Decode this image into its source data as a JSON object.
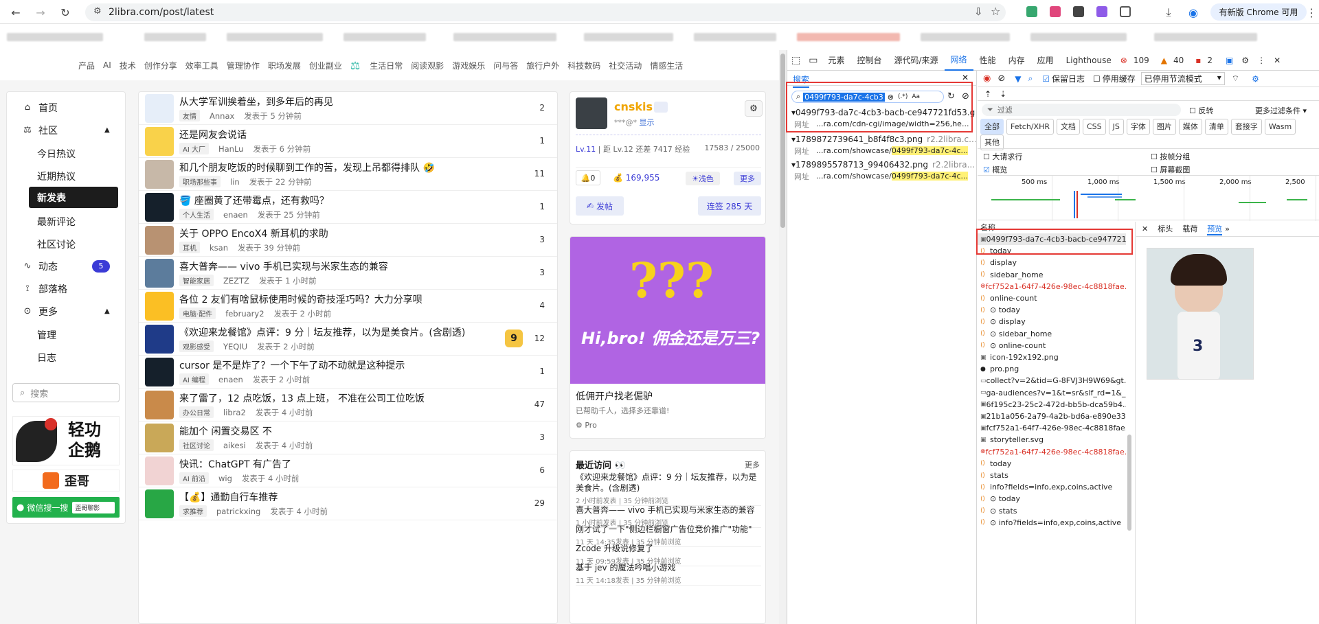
{
  "browser": {
    "url": "2libra.com/post/latest",
    "update_label": "有新版 Chrome 可用"
  },
  "topnav": [
    "产品",
    "AI",
    "技术",
    "创作分享",
    "效率工具",
    "管理协作",
    "职场发展",
    "创业副业",
    "生活日常",
    "阅读观影",
    "游戏娱乐",
    "问与答",
    "旅行户外",
    "科技数码",
    "社交活动",
    "情感生活"
  ],
  "sidebar": {
    "home": "首页",
    "community": "社区",
    "sub1": [
      "今日热议",
      "近期热议"
    ],
    "new_posts": "新发表",
    "sub2": [
      "最新评论",
      "社区讨论"
    ],
    "activity": "动态",
    "activity_count": "5",
    "tribe": "部落格",
    "more": "更多",
    "sub3": [
      "管理",
      "日志"
    ],
    "search_placeholder": "搜索",
    "promo1_text": "轻功\n企鹅",
    "promo2_text": "歪哥",
    "promo3_text": "微信搜一搜",
    "promo3_box": "歪哥聊影"
  },
  "posts": [
    {
      "title": "从大学军训挨着坐，到多年后的再见",
      "tag": "友情",
      "author": "Annax",
      "time": "发表于 5 分钟前",
      "count": "2"
    },
    {
      "title": "还是网友会说话",
      "tag": "AI 大厂",
      "author": "HanLu",
      "time": "发表于 6 分钟前",
      "count": "1"
    },
    {
      "title": "和几个朋友吃饭的时候聊到工作的苦，发现上吊都得排队 🤣",
      "tag": "职场那些事",
      "author": "lin",
      "time": "发表于 22 分钟前",
      "count": "11"
    },
    {
      "title": "🪣 座圈黄了还带霉点，还有救吗？",
      "tag": "个人生活",
      "author": "enaen",
      "time": "发表于 25 分钟前",
      "count": "1"
    },
    {
      "title": "关于 OPPO EncoX4 新耳机的求助",
      "tag": "耳机",
      "author": "ksan",
      "time": "发表于 39 分钟前",
      "count": "3"
    },
    {
      "title": "喜大普奔—— vivo 手机已实现与米家生态的兼容",
      "tag": "智能家居",
      "author": "ZEZTZ",
      "time": "发表于 1 小时前",
      "count": "3"
    },
    {
      "title": "各位 2 友们有啥鼠标使用时候的奇技淫巧吗？大力分享呗",
      "tag": "电脑·配件",
      "author": "february2",
      "time": "发表于 2 小时前",
      "count": "4"
    },
    {
      "title": "《欢迎来龙餐馆》点评：9 分｜坛友推荐，以为是美食片。(含剧透)",
      "tag": "观影感受",
      "author": "YEQIU",
      "time": "发表于 2 小时前",
      "count": "12",
      "badge": "9"
    },
    {
      "title": "cursor 是不是炸了？一个下午了动不动就是这种提示",
      "tag": "AI 编程",
      "author": "enaen",
      "time": "发表于 2 小时前",
      "count": "1"
    },
    {
      "title": "来了雷了，12 点吃饭，13 点上班， 不准在公司工位吃饭",
      "tag": "办公日常",
      "author": "libra2",
      "time": "发表于 4 小时前",
      "count": "47"
    },
    {
      "title": "能加个 闲置交易区 不",
      "tag": "社区讨论",
      "author": "aikesi",
      "time": "发表于 4 小时前",
      "count": "3"
    },
    {
      "title": "快讯：ChatGPT 有广告了",
      "tag": "AI 前沿",
      "author": "wig",
      "time": "发表于 4 小时前",
      "count": "6"
    },
    {
      "title": "【💰】通勤自行车推荐",
      "tag": "求推荐",
      "author": "patrickxing",
      "time": "发表于 4 小时前",
      "count": "29"
    }
  ],
  "profile": {
    "name": "cnskis",
    "sub": "***@*",
    "show": "显示",
    "level": "Lv.11",
    "next": "距 Lv.12 还差 7417 经验",
    "exp": "17583 / 25000",
    "bell": "0",
    "coins": "169,955",
    "color_label": "浅色",
    "more": "更多",
    "post_btn": "发帖",
    "streak": "连签 285 天"
  },
  "ad": {
    "headline": "Hi,bro! 佣金还是万三?",
    "title": "低佣开户找老倔驴",
    "desc": "已帮助千人，选择多还靠谱!",
    "pro": "Pro"
  },
  "recent": {
    "title": "最近访问 👀",
    "more": "更多",
    "items": [
      {
        "t": "《欢迎来龙餐馆》点评：9 分｜坛友推荐，以为是美食片。(含剧透)",
        "m": "2 小时前发表  |  35 分钟前浏览"
      },
      {
        "t": "喜大普奔—— vivo 手机已实现与米家生态的兼容",
        "m": "1 小时前发表  |  35 分钟前浏览"
      },
      {
        "t": "刚才试了一下\"侧边栏橱窗广告位竞价推广\"功能\"",
        "m": "11 天 14:35发表  |  35 分钟前浏览"
      },
      {
        "t": "Zcode 升级说修复了",
        "m": "11 天 09:59发表  |  35 分钟前浏览"
      },
      {
        "t": "基于 jev 的魔法吟唱小游戏",
        "m": "11 天 14:18发表  |  35 分钟前浏览"
      }
    ]
  },
  "devtools": {
    "tabs": [
      "元素",
      "控制台",
      "源代码/来源",
      "网络",
      "性能",
      "内存",
      "应用",
      "Lighthouse"
    ],
    "errors": "109",
    "warnings": "40",
    "issues": "2",
    "search_tab": "搜索",
    "search_value": "0499f793-da7c-4cb3",
    "regex": "(.*)",
    "case": "Aa",
    "results": [
      {
        "file": "0499f793-da7c-4cb3-bacb-ce947721fd53.gi...",
        "line_label": "网址",
        "line": "...ra.com/cdn-cgi/image/width=256,he..."
      },
      {
        "file": "1789872739641_b8f4f8c3.png",
        "host": "r2.2libra.c...",
        "line_label": "网址",
        "line_pre": "...ra.com/showcase/",
        "line_hl": "0499f793-da7c-4c..."
      },
      {
        "file": "1789895578713_99406432.png",
        "host": "r2.2libra...",
        "line_label": "网址",
        "line_pre": "...ra.com/showcase/",
        "line_hl": "0499f793-da7c-4c..."
      }
    ],
    "preserve_log": "保留日志",
    "disable_cache": "停用缓存",
    "throttle": "已停用节流模式",
    "filter_placeholder": "过滤",
    "invert": "反转",
    "more_filters": "更多过滤条件",
    "types": [
      "全部",
      "Fetch/XHR",
      "文档",
      "CSS",
      "JS",
      "字体",
      "图片",
      "媒体",
      "清单",
      "套接字",
      "Wasm",
      "其他"
    ],
    "big_rows": "大请求行",
    "group_frame": "按帧分组",
    "overview": "概览",
    "screenshots": "屏幕截图",
    "timeline": [
      "500 ms",
      "1,000 ms",
      "1,500 ms",
      "2,000 ms",
      "2,500"
    ],
    "col_name": "名称",
    "detail_tabs": [
      "标头",
      "载荷",
      "预览"
    ],
    "requests": [
      {
        "n": "0499f793-da7c-4cb3-bacb-ce947721...",
        "t": "img",
        "sel": true
      },
      {
        "n": "today",
        "t": "xhr"
      },
      {
        "n": "display",
        "t": "xhr"
      },
      {
        "n": "sidebar_home",
        "t": "xhr"
      },
      {
        "n": "fcf752a1-64f7-426e-98ec-4c8818fae...",
        "t": "err"
      },
      {
        "n": "online-count",
        "t": "xhr"
      },
      {
        "n": "⊙ today",
        "t": "xhr"
      },
      {
        "n": "⊙ display",
        "t": "xhr"
      },
      {
        "n": "⊙ sidebar_home",
        "t": "xhr"
      },
      {
        "n": "⊙ online-count",
        "t": "xhr"
      },
      {
        "n": "icon-192x192.png",
        "t": "img"
      },
      {
        "n": "pro.png",
        "t": "pro"
      },
      {
        "n": "collect?v=2&tid=G-8FVJ3H9W69&gt...",
        "t": "doc"
      },
      {
        "n": "ga-audiences?v=1&t=sr&slf_rd=1&_...",
        "t": "doc"
      },
      {
        "n": "6f195c23-25c2-472d-bb5b-dca59b4...",
        "t": "img"
      },
      {
        "n": "21b1a056-2a79-4a2b-bd6a-e890e33...",
        "t": "img"
      },
      {
        "n": "fcf752a1-64f7-426e-98ec-4c8818fae...",
        "t": "img"
      },
      {
        "n": "storyteller.svg",
        "t": "img"
      },
      {
        "n": "fcf752a1-64f7-426e-98ec-4c8818fae...",
        "t": "err"
      },
      {
        "n": "today",
        "t": "xhr"
      },
      {
        "n": "stats",
        "t": "xhr"
      },
      {
        "n": "info?fields=info,exp,coins,active",
        "t": "xhr"
      },
      {
        "n": "⊙ today",
        "t": "xhr"
      },
      {
        "n": "⊙ stats",
        "t": "xhr"
      },
      {
        "n": "⊙ info?fields=info,exp,coins,active",
        "t": "xhr"
      }
    ]
  }
}
